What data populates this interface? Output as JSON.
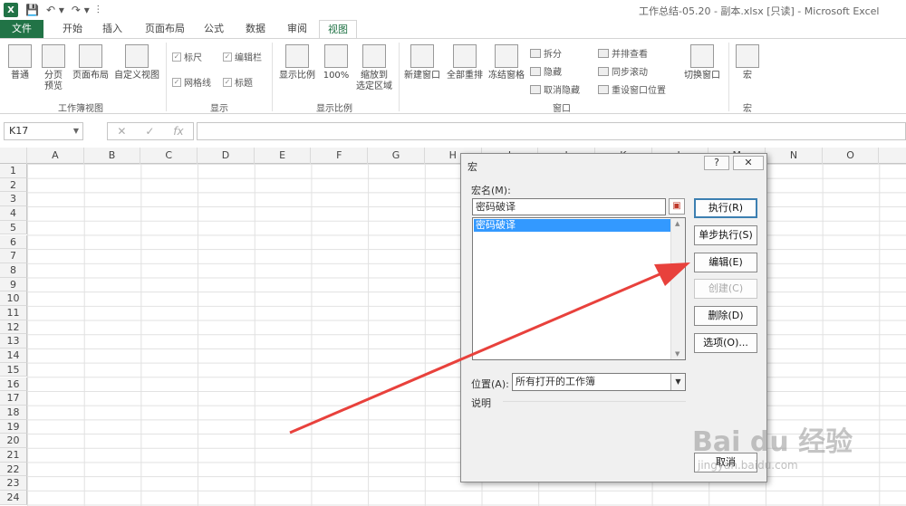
{
  "window": {
    "title": "工作总结-05.20 - 副本.xlsx  [只读] - Microsoft Excel",
    "logo": "X"
  },
  "qat": {
    "save": "💾",
    "undo": "↶ ▾",
    "redo": "↷ ▾",
    "more": "⫶"
  },
  "tabs": [
    "文件",
    "开始",
    "插入",
    "页面布局",
    "公式",
    "数据",
    "审阅",
    "视图"
  ],
  "ribbon": {
    "views": {
      "normal": "普通",
      "page_break": "分页\n预览",
      "page_layout": "页面布局",
      "custom": "自定义视图",
      "group": "工作簿视图"
    },
    "show": {
      "ruler": "标尺",
      "formula_bar": "编辑栏",
      "gridlines": "网格线",
      "headings": "标题",
      "group": "显示"
    },
    "zoom": {
      "zoom": "显示比例",
      "hundred": "100%",
      "to_sel": "缩放到\n选定区域",
      "group": "显示比例"
    },
    "window": {
      "new": "新建窗口",
      "arrange": "全部重排",
      "freeze": "冻结窗格",
      "split": "拆分",
      "hide": "隐藏",
      "unhide": "取消隐藏",
      "side": "并排查看",
      "sync": "同步滚动",
      "reset": "重设窗口位置",
      "switch": "切换窗口",
      "group": "窗口"
    },
    "macros": {
      "macros": "宏",
      "group": "宏"
    }
  },
  "formula_bar": {
    "name_box": "K17",
    "cancel": "✕",
    "enter": "✓",
    "fx": "fx"
  },
  "columns": [
    "A",
    "B",
    "C",
    "D",
    "E",
    "F",
    "G",
    "H",
    "I",
    "J",
    "K",
    "L",
    "M",
    "N",
    "O"
  ],
  "rows": [
    "1",
    "2",
    "3",
    "4",
    "5",
    "6",
    "7",
    "8",
    "9",
    "10",
    "11",
    "12",
    "13",
    "14",
    "15",
    "16",
    "17",
    "18",
    "19",
    "20",
    "21",
    "22",
    "23",
    "24"
  ],
  "dialog": {
    "title": "宏",
    "help": "?",
    "close": "✕",
    "macro_name_label": "宏名(M):",
    "macro_name_value": "密码破译",
    "macros": [
      "密码破译"
    ],
    "buttons": {
      "run": "执行(R)",
      "step": "单步执行(S)",
      "edit": "编辑(E)",
      "create": "创建(C)",
      "delete": "删除(D)",
      "options": "选项(O)...",
      "cancel": "取消"
    },
    "location_label": "位置(A):",
    "location_value": "所有打开的工作簿",
    "description_label": "说明"
  },
  "watermark": {
    "brand": "Bai du 经验",
    "url": "jingyan.baidu.com"
  },
  "colors": {
    "accent": "#217346",
    "selection": "#3399ff",
    "arrow": "#e8413c"
  }
}
